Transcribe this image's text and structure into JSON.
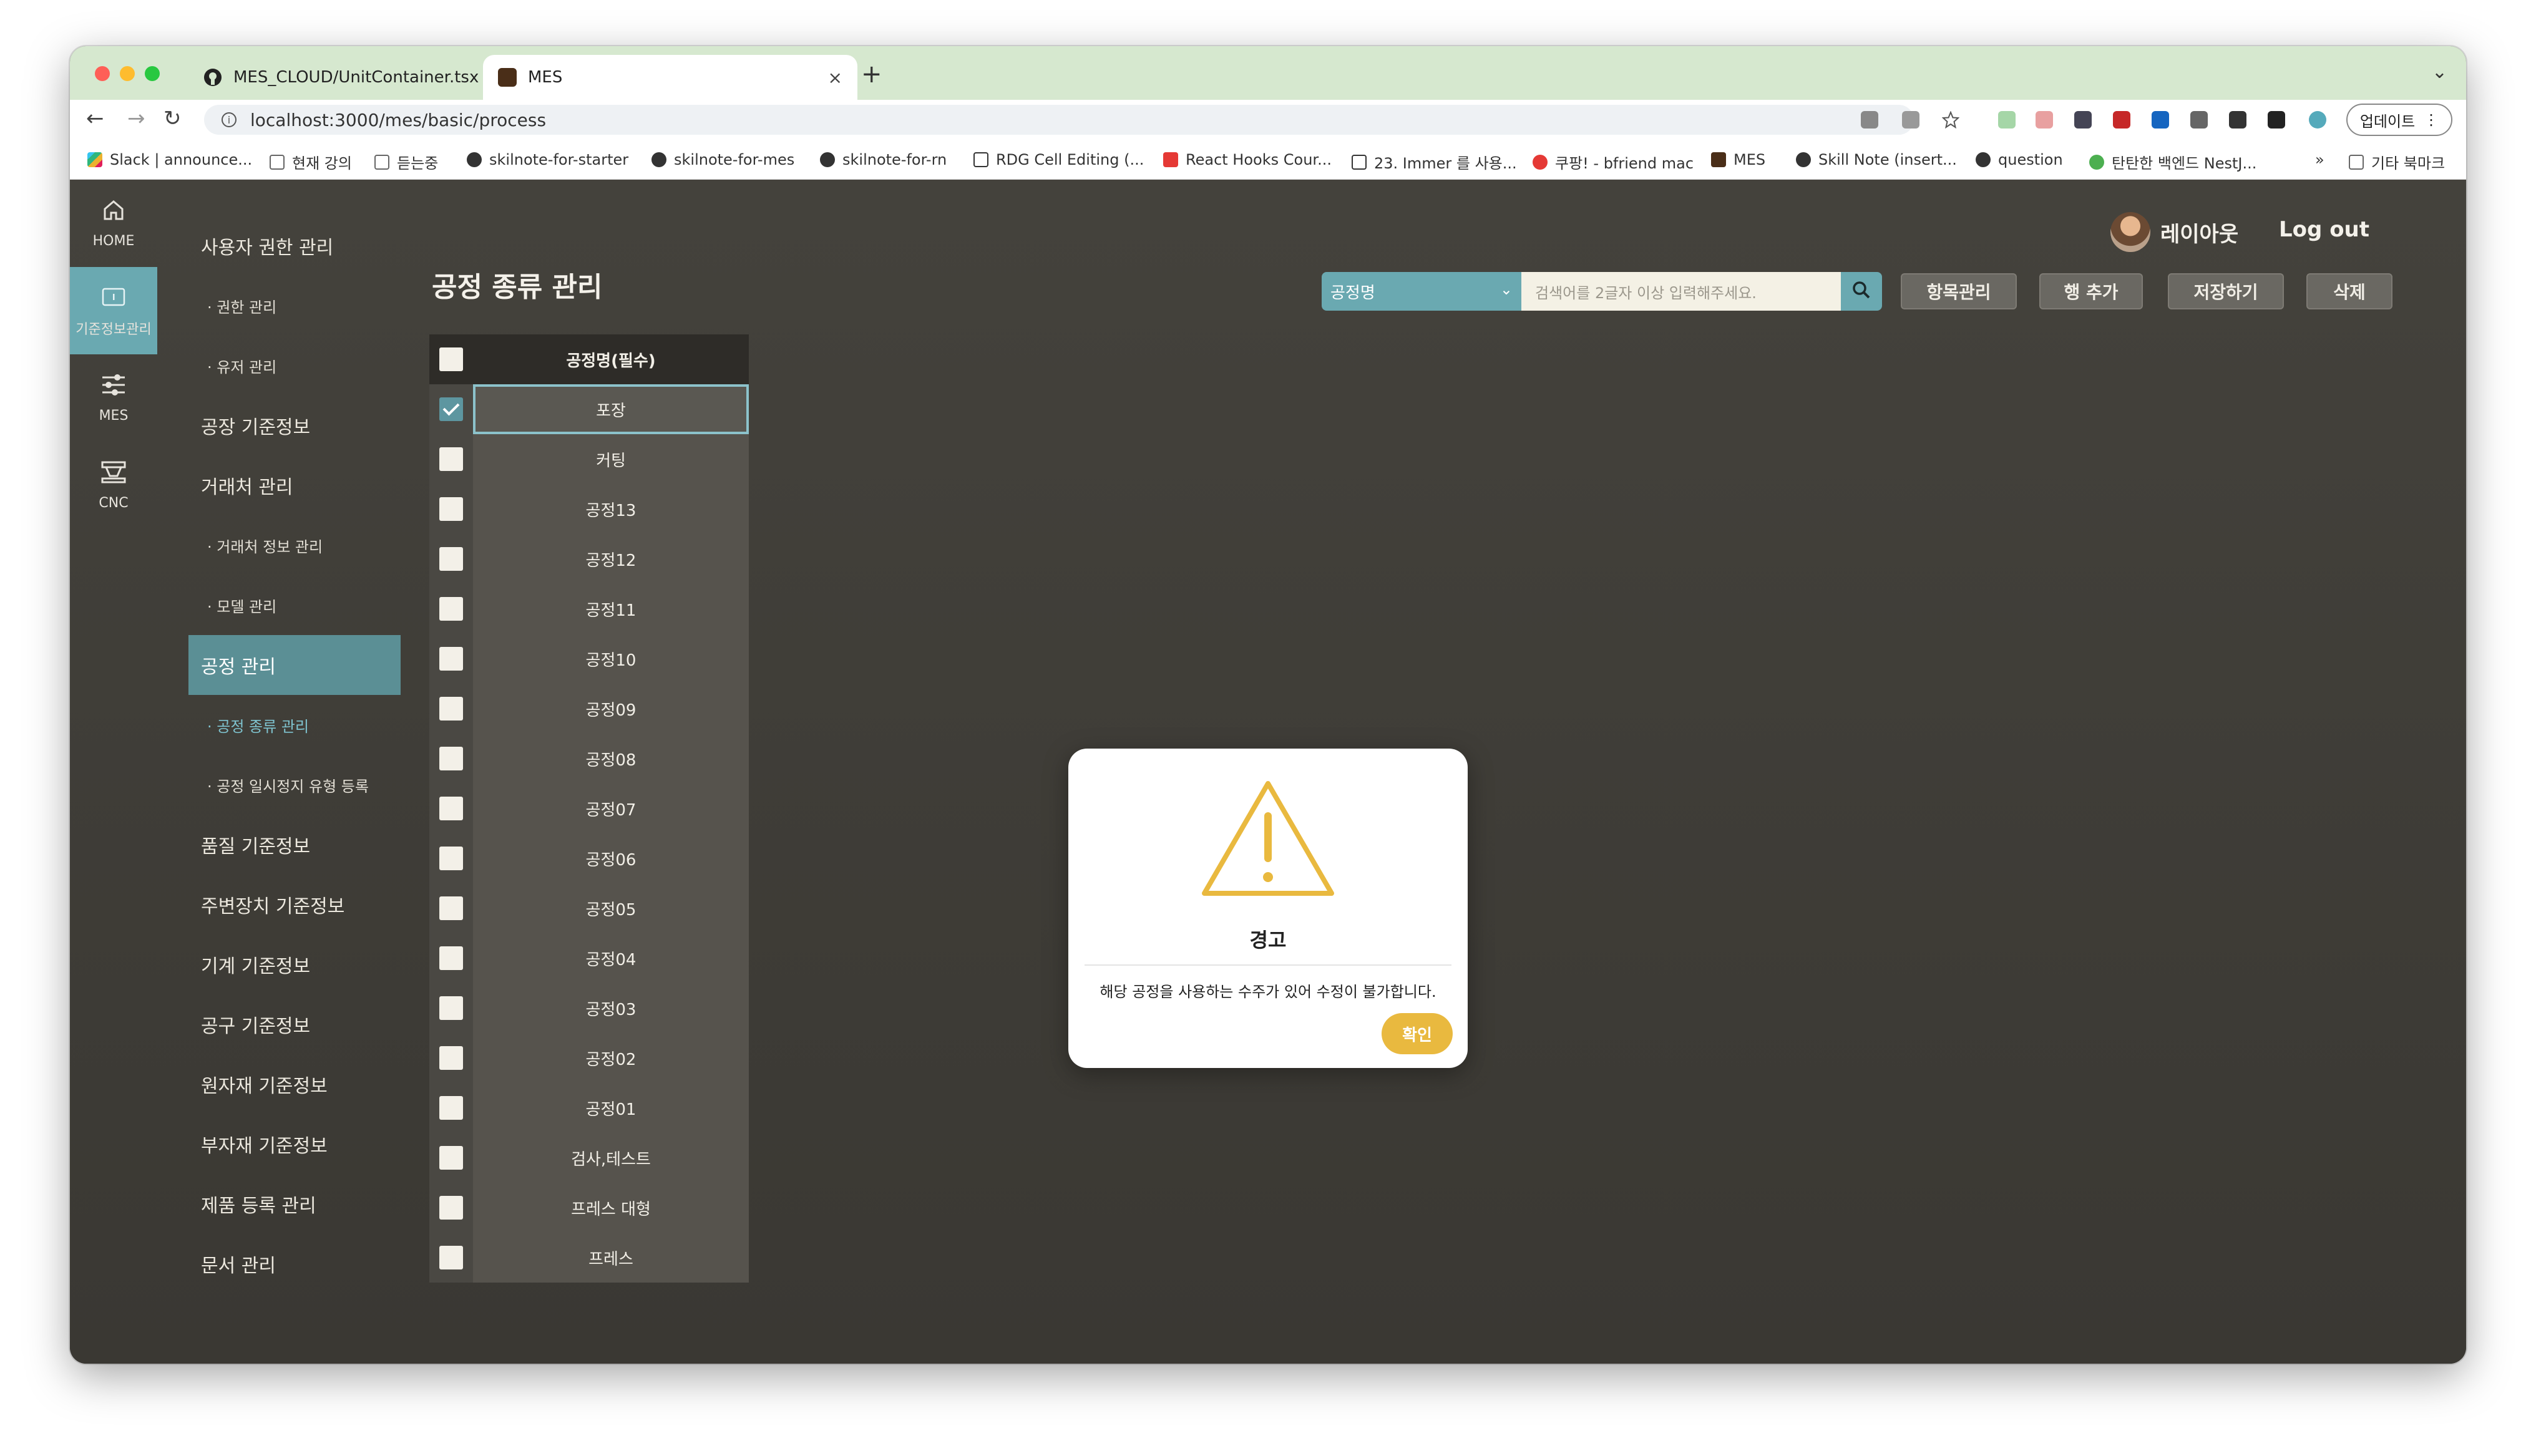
{
  "browser": {
    "tabs": [
      {
        "title": "MES_CLOUD/UnitContainer.tsx",
        "favicon": "github-icon",
        "close": "×"
      },
      {
        "title": "MES",
        "favicon": "mes-favicon",
        "close": "×"
      }
    ],
    "new_tab": "+",
    "url": "localhost:3000/mes/basic/process",
    "update_label": "업데이트",
    "bookmarks": [
      {
        "label": "Slack | announce...",
        "icon": "slack-icon"
      },
      {
        "label": "현재 강의",
        "icon": "folder-icon"
      },
      {
        "label": "듣는중",
        "icon": "folder-icon"
      },
      {
        "label": "skilnote-for-starter",
        "icon": "globe-icon"
      },
      {
        "label": "skilnote-for-mes",
        "icon": "globe-icon"
      },
      {
        "label": "skilnote-for-rn",
        "icon": "globe-icon"
      },
      {
        "label": "RDG Cell Editing (...",
        "icon": "page-icon"
      },
      {
        "label": "React Hooks Cour...",
        "icon": "youtube-icon"
      },
      {
        "label": "23. Immer 를 사용...",
        "icon": "book-icon"
      },
      {
        "label": "쿠팡! - bfriend mac",
        "icon": "coupang-icon"
      },
      {
        "label": "MES",
        "icon": "mes-favicon"
      },
      {
        "label": "Skill Note (insert...",
        "icon": "globe-icon"
      },
      {
        "label": "question",
        "icon": "globe-icon"
      },
      {
        "label": "탄탄한 백엔드 NestJ...",
        "icon": "globe-icon"
      }
    ],
    "bookmarks_more": "»",
    "other_bookmarks": "기타 북마크"
  },
  "rail": [
    {
      "label": "HOME",
      "icon": "home-icon"
    },
    {
      "label": "기준정보관리",
      "icon": "folder-icon"
    },
    {
      "label": "MES",
      "icon": "sliders-icon"
    },
    {
      "label": "CNC",
      "icon": "machine-icon"
    }
  ],
  "sidebar": [
    {
      "label": "사용자 권한 관리",
      "type": "main"
    },
    {
      "label": "· 권한 관리",
      "type": "sub"
    },
    {
      "label": "· 유저 관리",
      "type": "sub"
    },
    {
      "label": "공장 기준정보",
      "type": "main"
    },
    {
      "label": "거래처 관리",
      "type": "main"
    },
    {
      "label": "· 거래처 정보 관리",
      "type": "sub"
    },
    {
      "label": "· 모델 관리",
      "type": "sub"
    },
    {
      "label": "공정 관리",
      "type": "main"
    },
    {
      "label": "· 공정 종류 관리",
      "type": "sub"
    },
    {
      "label": "· 공정 일시정지 유형 등록",
      "type": "sub"
    },
    {
      "label": "품질 기준정보",
      "type": "main"
    },
    {
      "label": "주변장치 기준정보",
      "type": "main"
    },
    {
      "label": "기계 기준정보",
      "type": "main"
    },
    {
      "label": "공구 기준정보",
      "type": "main"
    },
    {
      "label": "원자재 기준정보",
      "type": "main"
    },
    {
      "label": "부자재 기준정보",
      "type": "main"
    },
    {
      "label": "제품 등록 관리",
      "type": "main"
    },
    {
      "label": "문서 관리",
      "type": "main"
    }
  ],
  "page": {
    "title": "공정 종류 관리",
    "search_select": "공정명",
    "search_placeholder": "검색어를 2글자 이상 입력해주세요.",
    "buttons": [
      "항목관리",
      "행 추가",
      "저장하기",
      "삭제"
    ]
  },
  "user": {
    "name": "레이아웃",
    "logout": "Log out"
  },
  "table": {
    "header": "공정명(필수)",
    "rows": [
      {
        "name": "포장",
        "checked": true
      },
      {
        "name": "커팅",
        "checked": false
      },
      {
        "name": "공정13",
        "checked": false
      },
      {
        "name": "공정12",
        "checked": false
      },
      {
        "name": "공정11",
        "checked": false
      },
      {
        "name": "공정10",
        "checked": false
      },
      {
        "name": "공정09",
        "checked": false
      },
      {
        "name": "공정08",
        "checked": false
      },
      {
        "name": "공정07",
        "checked": false
      },
      {
        "name": "공정06",
        "checked": false
      },
      {
        "name": "공정05",
        "checked": false
      },
      {
        "name": "공정04",
        "checked": false
      },
      {
        "name": "공정03",
        "checked": false
      },
      {
        "name": "공정02",
        "checked": false
      },
      {
        "name": "공정01",
        "checked": false
      },
      {
        "name": "검사,테스트",
        "checked": false
      },
      {
        "name": "프레스 대형",
        "checked": false
      },
      {
        "name": "프레스",
        "checked": false
      }
    ]
  },
  "modal": {
    "title": "경고",
    "message": "해당 공정을 사용하는 수주가 있어 수정이 불가합니다.",
    "confirm": "확인"
  },
  "colors": {
    "accent": "#6aa9b1",
    "warning": "#e9b93f",
    "background": "#3e3c37"
  }
}
